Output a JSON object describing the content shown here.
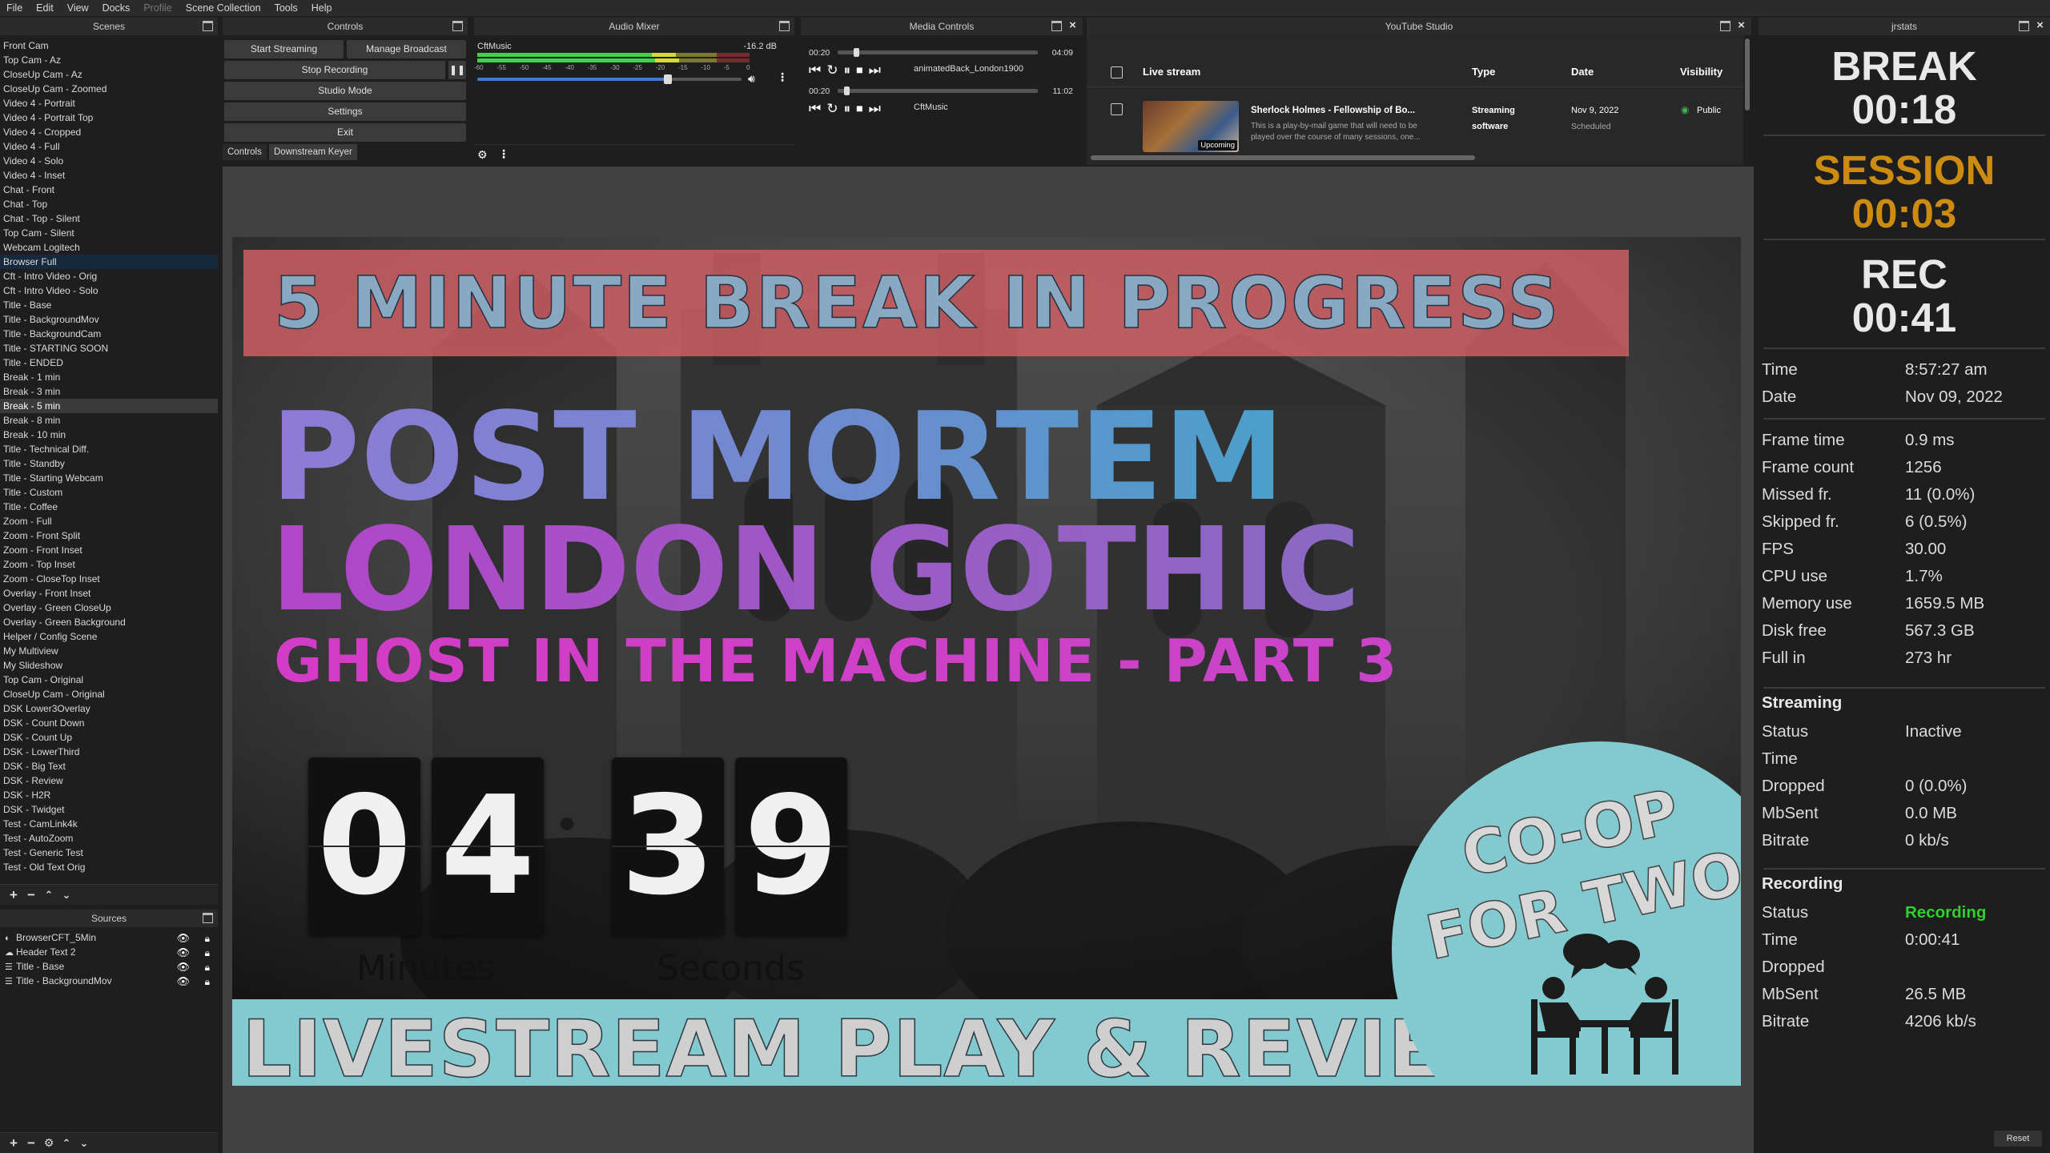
{
  "menu": [
    "File",
    "Edit",
    "View",
    "Docks",
    "Profile",
    "Scene Collection",
    "Tools",
    "Help"
  ],
  "scenes": {
    "title": "Scenes",
    "items": [
      "Front Cam",
      "Top Cam - Az",
      "CloseUp Cam - Az",
      "CloseUp Cam - Zoomed",
      "Video 4 - Portrait",
      "Video 4 - Portrait Top",
      "Video 4 - Cropped",
      "Video 4 - Full",
      "Video 4 - Solo",
      "Video 4 - Inset",
      "Chat - Front",
      "Chat - Top",
      "Chat - Top - Silent",
      "Top Cam - Silent",
      "Webcam Logitech",
      "Browser Full",
      "Cft - Intro Video - Orig",
      "Cft - Intro Video - Solo",
      "Title - Base",
      "Title - BackgroundMov",
      "Title - BackgroundCam",
      "Title - STARTING SOON",
      "Title - ENDED",
      "Break - 1 min",
      "Break - 3 min",
      "Break - 5 min",
      "Break - 8 min",
      "Break - 10 min",
      "Title - Technical Diff.",
      "Title - Standby",
      "Title - Starting Webcam",
      "Title - Custom",
      "Title - Coffee",
      "Zoom - Full",
      "Zoom - Front Split",
      "Zoom - Front Inset",
      "Zoom - Top Inset",
      "Zoom - CloseTop Inset",
      "Overlay - Front Inset",
      "Overlay - Green CloseUp",
      "Overlay - Green Background",
      "Helper / Config Scene",
      "My Multiview",
      "My Slideshow",
      "Top Cam - Original",
      "CloseUp Cam - Original",
      "DSK Lower3Overlay",
      "DSK - Count Down",
      "DSK - Count Up",
      "DSK - LowerThird",
      "DSK - Big Text",
      "DSK - Review",
      "DSK - H2R",
      "DSK - Twidget",
      "Test - CamLink4k",
      "Test - AutoZoom",
      "Test - Generic Test",
      "Test - Old Text Orig"
    ],
    "highlighted": "Browser Full",
    "selected": "Break - 5 min"
  },
  "sources": {
    "title": "Sources",
    "items": [
      "BrowserCFT_5Min",
      "Header Text 2",
      "Title - Base",
      "Title - BackgroundMov"
    ]
  },
  "controls": {
    "title": "Controls",
    "start_streaming": "Start Streaming",
    "manage_broadcast": "Manage Broadcast",
    "stop_recording": "Stop Recording",
    "studio_mode": "Studio Mode",
    "settings": "Settings",
    "exit": "Exit",
    "tab_controls": "Controls",
    "tab_dsk": "Downstream Keyer"
  },
  "mixer": {
    "title": "Audio Mixer",
    "source": "CftMusic",
    "db": "-16.2 dB",
    "scale": [
      "-60",
      "-55",
      "-50",
      "-45",
      "-40",
      "-35",
      "-30",
      "-25",
      "-20",
      "-15",
      "-10",
      "-5",
      "0"
    ],
    "volume_fraction": 0.72
  },
  "media": {
    "title": "Media Controls",
    "rows": [
      {
        "elapsed": "00:20",
        "duration": "04:09",
        "name": "animatedBack_London1900",
        "progress": 0.08
      },
      {
        "elapsed": "00:20",
        "duration": "11:02",
        "name": "CftMusic",
        "progress": 0.03
      }
    ]
  },
  "youtube": {
    "title": "YouTube Studio",
    "headers": {
      "stream": "Live stream",
      "type": "Type",
      "date": "Date",
      "visibility": "Visibility"
    },
    "row": {
      "title": "Sherlock Holmes - Fellowship of Bo...",
      "desc1": "This is a play-by-mail game that will need to be",
      "desc2": "played over the course of many sessions, one...",
      "type1": "Streaming",
      "type2": "software",
      "date": "Nov 9, 2022",
      "date_sub": "Scheduled",
      "visibility": "Public",
      "badge": "Upcoming"
    }
  },
  "stats": {
    "title": "jrstats",
    "break_label": "BREAK",
    "break_time": "00:18",
    "session_label": "SESSION",
    "session_time": "00:03",
    "rec_label": "REC",
    "rec_time": "00:41",
    "time_label": "Time",
    "time_value": "8:57:27 am",
    "date_label": "Date",
    "date_value": "Nov 09, 2022",
    "perf": [
      {
        "label": "Frame time",
        "value": "0.9 ms"
      },
      {
        "label": "Frame count",
        "value": "1256"
      },
      {
        "label": "Missed fr.",
        "value": "11 (0.0%)"
      },
      {
        "label": "Skipped fr.",
        "value": "6 (0.5%)"
      },
      {
        "label": "FPS",
        "value": "30.00"
      },
      {
        "label": "CPU use",
        "value": "1.7%"
      },
      {
        "label": "Memory use",
        "value": "1659.5 MB"
      },
      {
        "label": "Disk free",
        "value": "567.3 GB"
      },
      {
        "label": "Full in",
        "value": "273 hr"
      }
    ],
    "streaming_head": "Streaming",
    "streaming": [
      {
        "label": "Status",
        "value": "Inactive"
      },
      {
        "label": "Time",
        "value": ""
      },
      {
        "label": "Dropped",
        "value": "0 (0.0%)"
      },
      {
        "label": "MbSent",
        "value": "0.0 MB"
      },
      {
        "label": "Bitrate",
        "value": "0 kb/s"
      }
    ],
    "recording_head": "Recording",
    "recording": [
      {
        "label": "Status",
        "value": "Recording"
      },
      {
        "label": "Time",
        "value": "0:00:41"
      },
      {
        "label": "Dropped",
        "value": ""
      },
      {
        "label": "MbSent",
        "value": "26.5 MB"
      },
      {
        "label": "Bitrate",
        "value": "4206 kb/s"
      }
    ],
    "reset": "Reset",
    "colors": {
      "session": "#ce8b12",
      "recording": "#2fd12f"
    }
  },
  "preview": {
    "banner": "5 MINUTE BREAK IN PROGRESS",
    "title1": "POST MORTEM",
    "title2": "LONDON GOTHIC",
    "title3": "GHOST IN THE MACHINE - PART 3",
    "digits": [
      "0",
      "4",
      "3",
      "9"
    ],
    "minutes_label": "Minutes",
    "seconds_label": "Seconds",
    "bottom": "LIVESTREAM PLAY & REVIEW",
    "coop1": "CO-OP",
    "coop2": "FOR TWO"
  }
}
